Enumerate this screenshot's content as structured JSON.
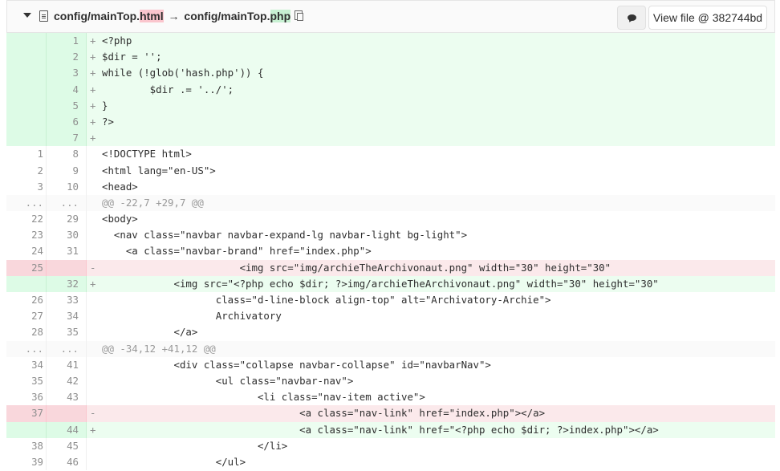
{
  "header": {
    "old_path_prefix": "config/mainTop.",
    "old_path_ext": "html",
    "arrow": "→",
    "new_path_prefix": "config/mainTop.",
    "new_path_ext": "php",
    "view_file_label": "View file @ 382744bd"
  },
  "diff_rows": [
    {
      "type": "add",
      "old": "",
      "new": "1",
      "sign": "+",
      "code": "<?php"
    },
    {
      "type": "add",
      "old": "",
      "new": "2",
      "sign": "+",
      "code": "$dir = '';"
    },
    {
      "type": "add",
      "old": "",
      "new": "3",
      "sign": "+",
      "code": "while (!glob('hash.php')) {"
    },
    {
      "type": "add",
      "old": "",
      "new": "4",
      "sign": "+",
      "code": "        $dir .= '../';"
    },
    {
      "type": "add",
      "old": "",
      "new": "5",
      "sign": "+",
      "code": "}"
    },
    {
      "type": "add",
      "old": "",
      "new": "6",
      "sign": "+",
      "code": "?>"
    },
    {
      "type": "add",
      "old": "",
      "new": "7",
      "sign": "+",
      "code": ""
    },
    {
      "type": "ctx",
      "old": "1",
      "new": "8",
      "sign": "",
      "code": "<!DOCTYPE html>"
    },
    {
      "type": "ctx",
      "old": "2",
      "new": "9",
      "sign": "",
      "code": "<html lang=\"en-US\">"
    },
    {
      "type": "ctx",
      "old": "3",
      "new": "10",
      "sign": "",
      "code": "<head>"
    },
    {
      "type": "match",
      "old": "...",
      "new": "...",
      "sign": "",
      "code": "@@ -22,7 +29,7 @@"
    },
    {
      "type": "ctx",
      "old": "22",
      "new": "29",
      "sign": "",
      "code": "<body>"
    },
    {
      "type": "ctx",
      "old": "23",
      "new": "30",
      "sign": "",
      "code": "  <nav class=\"navbar navbar-expand-lg navbar-light bg-light\">"
    },
    {
      "type": "ctx",
      "old": "24",
      "new": "31",
      "sign": "",
      "code": "    <a class=\"navbar-brand\" href=\"index.php\">"
    },
    {
      "type": "del",
      "old": "25",
      "new": "",
      "sign": "-",
      "code": "                       <img src=\"img/archieTheArchivonaut.png\" width=\"30\" height=\"30\""
    },
    {
      "type": "add",
      "old": "",
      "new": "32",
      "sign": "+",
      "code": "            <img src=\"<?php echo $dir; ?>img/archieTheArchivonaut.png\" width=\"30\" height=\"30\""
    },
    {
      "type": "ctx",
      "old": "26",
      "new": "33",
      "sign": "",
      "code": "                   class=\"d-line-block align-top\" alt=\"Archivatory-Archie\">"
    },
    {
      "type": "ctx",
      "old": "27",
      "new": "34",
      "sign": "",
      "code": "                   Archivatory"
    },
    {
      "type": "ctx",
      "old": "28",
      "new": "35",
      "sign": "",
      "code": "            </a>"
    },
    {
      "type": "match",
      "old": "...",
      "new": "...",
      "sign": "",
      "code": "@@ -34,12 +41,12 @@"
    },
    {
      "type": "ctx",
      "old": "34",
      "new": "41",
      "sign": "",
      "code": "            <div class=\"collapse navbar-collapse\" id=\"navbarNav\">"
    },
    {
      "type": "ctx",
      "old": "35",
      "new": "42",
      "sign": "",
      "code": "                   <ul class=\"navbar-nav\">"
    },
    {
      "type": "ctx",
      "old": "36",
      "new": "43",
      "sign": "",
      "code": "                          <li class=\"nav-item active\">"
    },
    {
      "type": "del",
      "old": "37",
      "new": "",
      "sign": "-",
      "code": "                                 <a class=\"nav-link\" href=\"index.php\"></a>"
    },
    {
      "type": "add",
      "old": "",
      "new": "44",
      "sign": "+",
      "code": "                                 <a class=\"nav-link\" href=\"<?php echo $dir; ?>index.php\"></a>"
    },
    {
      "type": "ctx",
      "old": "38",
      "new": "45",
      "sign": "",
      "code": "                          </li>"
    },
    {
      "type": "ctx",
      "old": "39",
      "new": "46",
      "sign": "",
      "code": "                   </ul>"
    }
  ]
}
